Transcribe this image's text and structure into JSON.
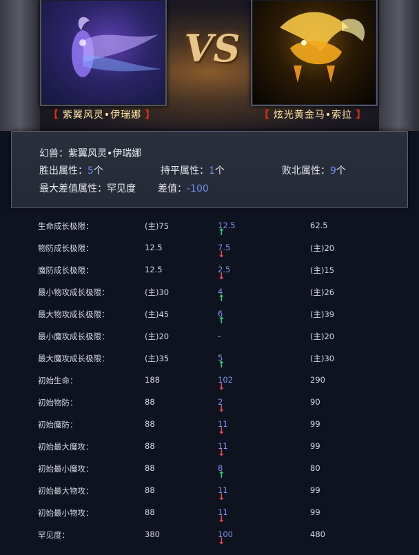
{
  "banner": {
    "vs_text": "VS",
    "left_pet": {
      "name": "紫翼风灵•伊瑞娜",
      "bracket_open": "【",
      "bracket_close": "】"
    },
    "right_pet": {
      "name": "炫光黄金马•索拉",
      "bracket_open": "【",
      "bracket_close": "】"
    }
  },
  "summary": {
    "pet_label": "幻兽：",
    "pet_name": "紫翼风灵•伊瑞娜",
    "win_label": "胜出属性：",
    "win_count": "5",
    "win_unit": "个",
    "tie_label": "持平属性：",
    "tie_count": "1",
    "tie_unit": "个",
    "lose_label": "败北属性：",
    "lose_count": "9",
    "lose_unit": "个",
    "maxdiff_label": "最大差值属性：罕见度",
    "diff_label": "差值：",
    "diff_value": "-100"
  },
  "colors": {
    "up": "#35d07a",
    "down": "#e84a5a",
    "value_blue": "#7d95ea",
    "bracket_red": "#d8301e"
  },
  "rows": [
    {
      "label": "生命成长极限：",
      "left": "(主)75",
      "dir": "up",
      "arrow": "↑",
      "diff": "12.5",
      "right": "62.5"
    },
    {
      "label": "物防成长极限：",
      "left": "12.5",
      "dir": "down",
      "arrow": "↓",
      "diff": "7.5",
      "right": "(主)20"
    },
    {
      "label": "魔防成长极限：",
      "left": "12.5",
      "dir": "down",
      "arrow": "↓",
      "diff": "2.5",
      "right": "(主)15"
    },
    {
      "label": "最小物攻成长极限：",
      "left": "(主)30",
      "dir": "up",
      "arrow": "↑",
      "diff": "4",
      "right": "(主)26"
    },
    {
      "label": "最大物攻成长极限：",
      "left": "(主)45",
      "dir": "up",
      "arrow": "↑",
      "diff": "6",
      "right": "(主)39"
    },
    {
      "label": "最小魔攻成长极限：",
      "left": "(主)20",
      "dir": "none",
      "arrow": "",
      "diff": "-",
      "right": "(主)20"
    },
    {
      "label": "最大魔攻成长极限：",
      "left": "(主)35",
      "dir": "up",
      "arrow": "↑",
      "diff": "5",
      "right": "(主)30"
    },
    {
      "label": "初始生命：",
      "left": "188",
      "dir": "down",
      "arrow": "↓",
      "diff": "102",
      "right": "290"
    },
    {
      "label": "初始物防：",
      "left": "88",
      "dir": "down",
      "arrow": "↓",
      "diff": "2",
      "right": "90"
    },
    {
      "label": "初始魔防：",
      "left": "88",
      "dir": "down",
      "arrow": "↓",
      "diff": "11",
      "right": "99"
    },
    {
      "label": "初始最大魔攻：",
      "left": "88",
      "dir": "down",
      "arrow": "↓",
      "diff": "11",
      "right": "99"
    },
    {
      "label": "初始最小魔攻：",
      "left": "88",
      "dir": "up",
      "arrow": "↑",
      "diff": "8",
      "right": "80"
    },
    {
      "label": "初始最大物攻：",
      "left": "88",
      "dir": "down",
      "arrow": "↓",
      "diff": "11",
      "right": "99"
    },
    {
      "label": "初始最小物攻：",
      "left": "88",
      "dir": "down",
      "arrow": "↓",
      "diff": "11",
      "right": "99"
    },
    {
      "label": "罕见度：",
      "left": "380",
      "dir": "down",
      "arrow": "↓",
      "diff": "100",
      "right": "480"
    }
  ]
}
